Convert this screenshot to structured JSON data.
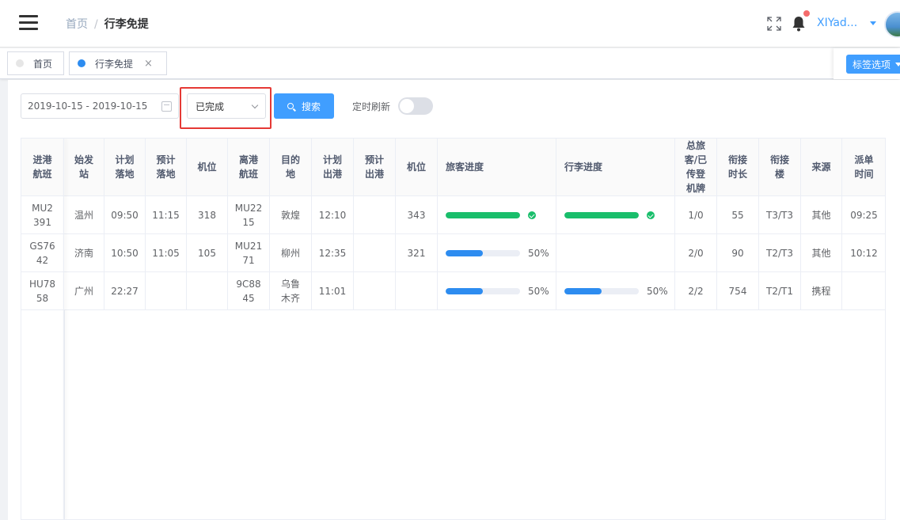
{
  "header": {
    "breadcrumb": [
      "首页",
      "行李免提"
    ],
    "username": "XIYad..."
  },
  "tabs": [
    {
      "label": "首页",
      "active": false
    },
    {
      "label": "行李免提",
      "active": true
    }
  ],
  "tab_options_label": "标签选项",
  "filters": {
    "date_range": "2019-10-15 - 2019-10-15",
    "status": "已完成",
    "search_label": "搜索",
    "timer_label": "定时刷新",
    "timer_on": false
  },
  "table": {
    "headers": [
      "进港\n航班",
      "始发\n站",
      "计划\n落地",
      "预计\n落地",
      "机位",
      "离港\n航班",
      "目的\n地",
      "计划\n出港",
      "预计\n出港",
      "机位",
      "旅客进度",
      "行李进度",
      "总旅\n客/已\n传登\n机牌",
      "衔接\n时长",
      "衔接\n楼",
      "来源",
      "派单\n时间"
    ],
    "rows": [
      {
        "in_flight": "MU2\n391",
        "origin": "温州",
        "plan_land": "09:50",
        "est_land": "11:15",
        "stand_in": "318",
        "out_flight": "MU22\n15",
        "dest": "敦煌",
        "plan_dep": "12:10",
        "est_dep": "",
        "stand_out": "343",
        "pax_progress": 100,
        "pax_text": "",
        "bag_progress": 100,
        "bag_text": "",
        "pax_count": "1/0",
        "conn_time": "55",
        "conn_terminal": "T3/T3",
        "source": "其他",
        "dispatch": "09:25"
      },
      {
        "in_flight": "GS76\n42",
        "origin": "济南",
        "plan_land": "10:50",
        "est_land": "11:05",
        "stand_in": "105",
        "out_flight": "MU21\n71",
        "dest": "柳州",
        "plan_dep": "12:35",
        "est_dep": "",
        "stand_out": "321",
        "pax_progress": 50,
        "pax_text": "50%",
        "bag_progress": null,
        "bag_text": "",
        "pax_count": "2/0",
        "conn_time": "90",
        "conn_terminal": "T2/T3",
        "source": "其他",
        "dispatch": "10:12"
      },
      {
        "in_flight": "HU78\n58",
        "origin": "广州",
        "plan_land": "22:27",
        "est_land": "",
        "stand_in": "",
        "out_flight": "9C88\n45",
        "dest": "乌鲁\n木齐",
        "plan_dep": "11:01",
        "est_dep": "",
        "stand_out": "",
        "pax_progress": 50,
        "pax_text": "50%",
        "bag_progress": 50,
        "bag_text": "50%",
        "pax_count": "2/2",
        "conn_time": "754",
        "conn_terminal": "T2/T1",
        "source": "携程",
        "dispatch": ""
      }
    ]
  },
  "colors": {
    "primary": "#409eff",
    "success": "#19be6b",
    "highlight": "#e53935",
    "progress_blue": "#2d8cf0"
  }
}
